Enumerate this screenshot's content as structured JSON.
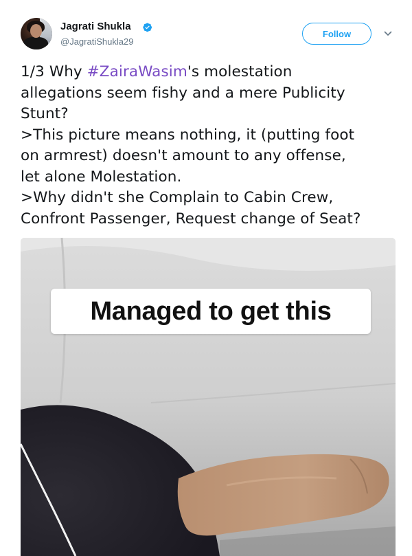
{
  "user": {
    "name": "Jagrati Shukla",
    "handle": "@JagratiShukla29"
  },
  "actions": {
    "follow_label": "Follow"
  },
  "tweet": {
    "line1_prefix": "1/3 Why ",
    "hashtag": "#ZairaWasim",
    "line1_suffix": "'s molestation",
    "line2": "allegations seem fishy and a mere Publicity",
    "line3": "Stunt?",
    "line4": ">This picture means nothing, it (putting foot",
    "line5": "on armrest) doesn't amount to any offense,",
    "line6": "let alone Molestation.",
    "line7": ">Why didn't she Complain to Cabin Crew,",
    "line8": "Confront Passenger, Request change of Seat?"
  },
  "media": {
    "caption": "Managed to get this"
  },
  "icons": {
    "verified": "verified-badge-icon",
    "caret": "chevron-down-icon"
  },
  "colors": {
    "accent": "#1da1f2",
    "hashtag": "#794bc4",
    "handle": "#657786",
    "text": "#14171a"
  }
}
